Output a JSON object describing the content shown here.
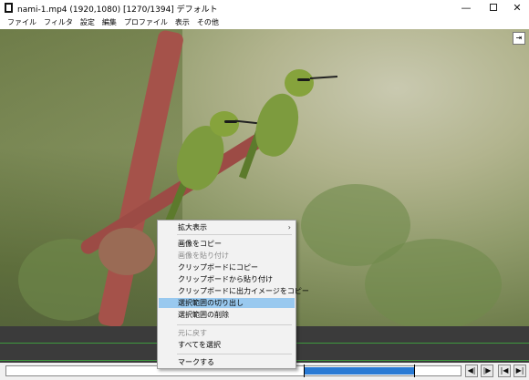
{
  "window": {
    "title": "nami-1.mp4 (1920,1080)  [1270/1394]  デフォルト",
    "minimize": "—",
    "maximize": "",
    "close": "✕"
  },
  "menubar": [
    {
      "label": "ファイル"
    },
    {
      "label": "フィルタ"
    },
    {
      "label": "設定"
    },
    {
      "label": "編集"
    },
    {
      "label": "プロファイル"
    },
    {
      "label": "表示"
    },
    {
      "label": "その他"
    }
  ],
  "video": {
    "expand_button": "⇥",
    "frame_current": 1270,
    "frame_total": 1394
  },
  "context_menu": {
    "items": [
      {
        "label": "拡大表示",
        "arrow": "›",
        "disabled": false,
        "highlighted": false
      },
      {
        "label": "画像をコピー",
        "disabled": false,
        "highlighted": false
      },
      {
        "label": "画像を貼り付け",
        "disabled": true,
        "highlighted": false
      },
      {
        "label": "クリップボードにコピー",
        "disabled": false,
        "highlighted": false
      },
      {
        "label": "クリップボードから貼り付け",
        "disabled": false,
        "highlighted": false
      },
      {
        "label": "クリップボードに出力イメージをコピー",
        "disabled": false,
        "highlighted": false
      },
      {
        "label": "選択範囲の切り出し",
        "disabled": false,
        "highlighted": true
      },
      {
        "label": "選択範囲の削除",
        "disabled": false,
        "highlighted": false
      },
      {
        "label": "元に戻す",
        "disabled": true,
        "highlighted": false
      },
      {
        "label": "すべてを選択",
        "disabled": false,
        "highlighted": false
      },
      {
        "label": "マークする",
        "disabled": false,
        "highlighted": false
      }
    ]
  },
  "controls": {
    "selection_start_fraction": 0.654,
    "selection_end_fraction": 0.898,
    "buttons": [
      {
        "label": "◀|",
        "icon": "step-back-icon"
      },
      {
        "label": "|▶",
        "icon": "step-forward-icon"
      },
      {
        "label": "|◀",
        "icon": "go-start-icon"
      },
      {
        "label": "▶|",
        "icon": "go-end-icon"
      }
    ]
  },
  "colors": {
    "selection": "#2a7ad4",
    "menu_highlight": "#99c9ef",
    "strip_line": "#3e9a3e"
  }
}
